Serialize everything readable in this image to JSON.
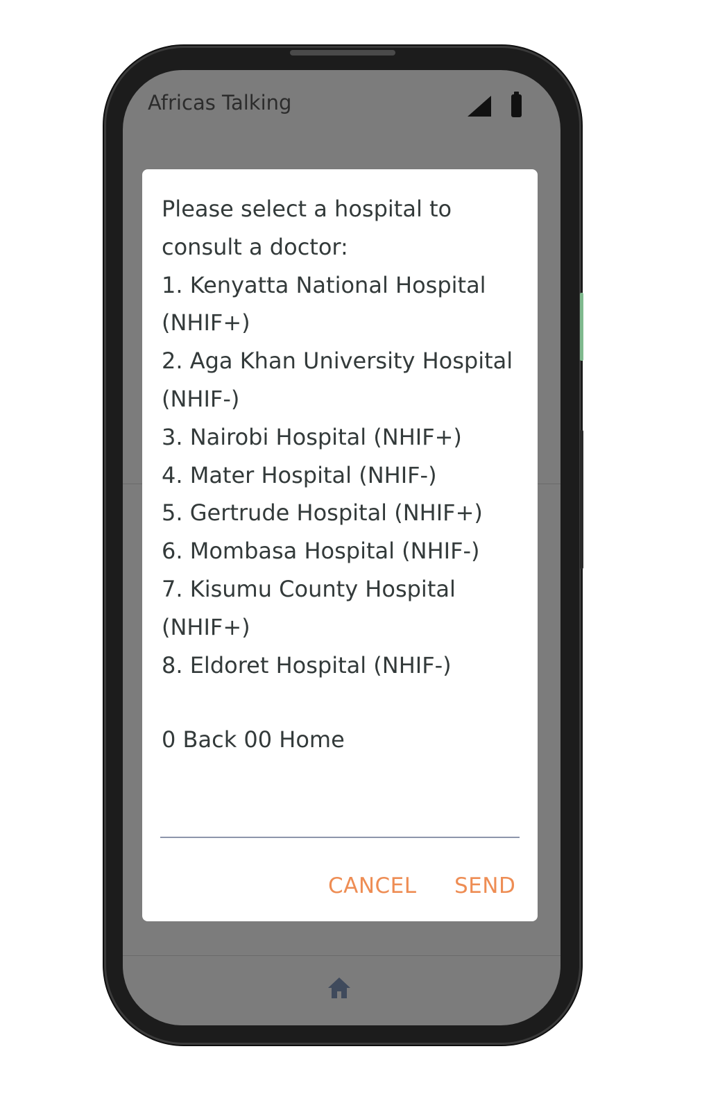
{
  "status_bar": {
    "app_title": "Africas Talking",
    "icons": [
      "signal-icon",
      "battery-icon"
    ]
  },
  "dialog": {
    "prompt_lines": [
      "Please select a hospital to",
      "consult a doctor:"
    ],
    "options": [
      "1. Kenyatta National Hospital",
      "(NHIF+)",
      "2. Aga Khan University Hospital",
      "(NHIF-)",
      "3. Nairobi Hospital (NHIF+)",
      "4. Mater Hospital (NHIF-)",
      "5. Gertrude Hospital (NHIF+)",
      "6. Mombasa Hospital (NHIF-)",
      "7. Kisumu County Hospital",
      "(NHIF+)",
      "8. Eldoret Hospital (NHIF-)"
    ],
    "footer": "0 Back 00 Home",
    "input_value": "",
    "buttons": {
      "cancel": "CANCEL",
      "send": "SEND"
    }
  },
  "nav_bar": {
    "icon": "home-icon"
  },
  "colors": {
    "accent": "#ee8d54",
    "screen_overlay": "#7c7c7c",
    "dialog_bg": "#ffffff",
    "text": "#333a3a",
    "input_underline": "#8d95ab"
  }
}
